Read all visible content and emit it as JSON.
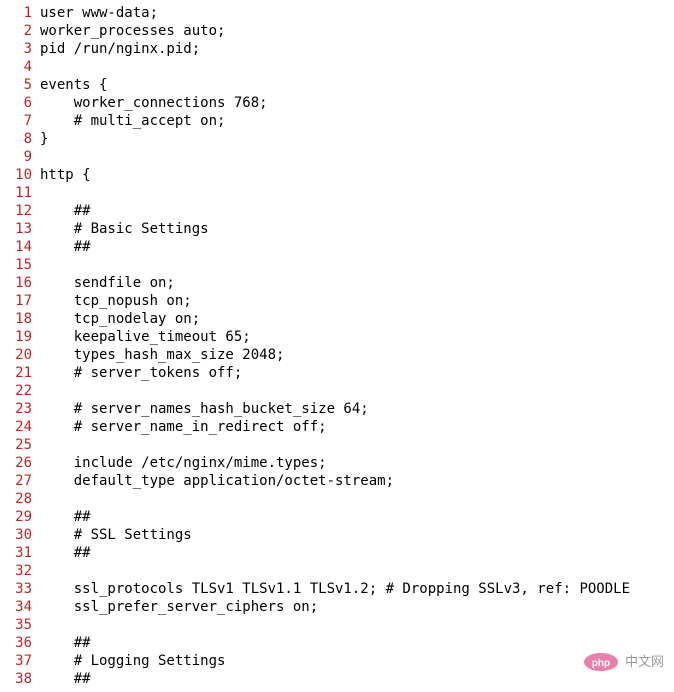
{
  "lines": [
    {
      "num": 1,
      "text": "user www-data;"
    },
    {
      "num": 2,
      "text": "worker_processes auto;"
    },
    {
      "num": 3,
      "text": "pid /run/nginx.pid;"
    },
    {
      "num": 4,
      "text": ""
    },
    {
      "num": 5,
      "text": "events {"
    },
    {
      "num": 6,
      "text": "    worker_connections 768;"
    },
    {
      "num": 7,
      "text": "    # multi_accept on;"
    },
    {
      "num": 8,
      "text": "}"
    },
    {
      "num": 9,
      "text": ""
    },
    {
      "num": 10,
      "text": "http {"
    },
    {
      "num": 11,
      "text": ""
    },
    {
      "num": 12,
      "text": "    ##"
    },
    {
      "num": 13,
      "text": "    # Basic Settings"
    },
    {
      "num": 14,
      "text": "    ##"
    },
    {
      "num": 15,
      "text": ""
    },
    {
      "num": 16,
      "text": "    sendfile on;"
    },
    {
      "num": 17,
      "text": "    tcp_nopush on;"
    },
    {
      "num": 18,
      "text": "    tcp_nodelay on;"
    },
    {
      "num": 19,
      "text": "    keepalive_timeout 65;"
    },
    {
      "num": 20,
      "text": "    types_hash_max_size 2048;"
    },
    {
      "num": 21,
      "text": "    # server_tokens off;"
    },
    {
      "num": 22,
      "text": ""
    },
    {
      "num": 23,
      "text": "    # server_names_hash_bucket_size 64;"
    },
    {
      "num": 24,
      "text": "    # server_name_in_redirect off;"
    },
    {
      "num": 25,
      "text": ""
    },
    {
      "num": 26,
      "text": "    include /etc/nginx/mime.types;"
    },
    {
      "num": 27,
      "text": "    default_type application/octet-stream;"
    },
    {
      "num": 28,
      "text": ""
    },
    {
      "num": 29,
      "text": "    ##"
    },
    {
      "num": 30,
      "text": "    # SSL Settings"
    },
    {
      "num": 31,
      "text": "    ##"
    },
    {
      "num": 32,
      "text": ""
    },
    {
      "num": 33,
      "text": "    ssl_protocols TLSv1 TLSv1.1 TLSv1.2; # Dropping SSLv3, ref: POODLE"
    },
    {
      "num": 34,
      "text": "    ssl_prefer_server_ciphers on;"
    },
    {
      "num": 35,
      "text": ""
    },
    {
      "num": 36,
      "text": "    ##"
    },
    {
      "num": 37,
      "text": "    # Logging Settings"
    },
    {
      "num": 38,
      "text": "    ##"
    }
  ],
  "watermark": {
    "text": "中文网",
    "prefix": "php"
  }
}
